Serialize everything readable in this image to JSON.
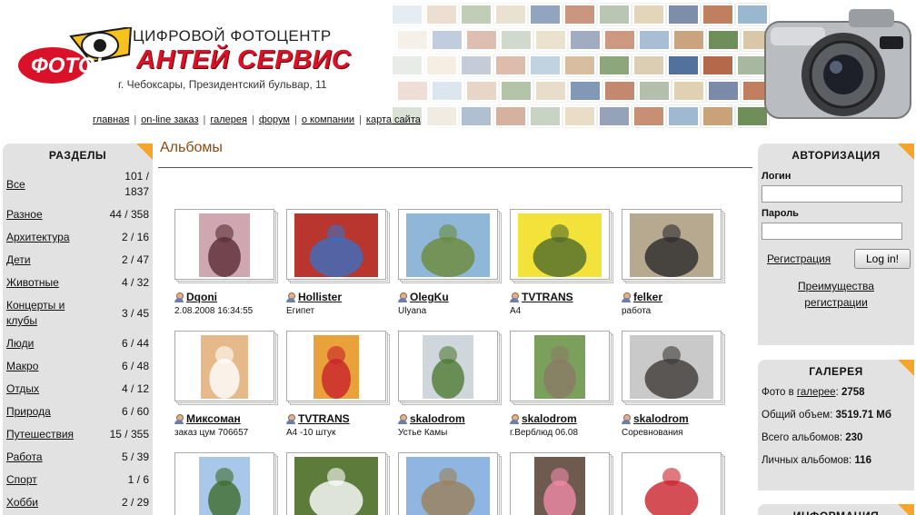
{
  "header": {
    "tagline": "ЦИФРОВОЙ ФОТОЦЕНТР",
    "brand": "АНТЕЙ СЕРВИС",
    "badge_text": "ФОТО!",
    "address": "г. Чебоксары, Президентский бульвар, 11"
  },
  "nav": [
    {
      "label": "главная"
    },
    {
      "label": "on-line заказ"
    },
    {
      "label": "галерея"
    },
    {
      "label": "форум"
    },
    {
      "label": "о компании"
    },
    {
      "label": "карта сайта"
    }
  ],
  "sections": {
    "title": "РАЗДЕЛЫ",
    "items": [
      {
        "label": "Все",
        "count": "101 / 1837"
      },
      {
        "label": "Разное",
        "count": "44 / 358"
      },
      {
        "label": "Архитектура",
        "count": "2 / 16"
      },
      {
        "label": "Дети",
        "count": "2 / 47"
      },
      {
        "label": "Животные",
        "count": "4 / 32"
      },
      {
        "label": "Концерты и клубы",
        "count": "3 / 45"
      },
      {
        "label": "Люди",
        "count": "6 / 44"
      },
      {
        "label": "Макро",
        "count": "6 / 48"
      },
      {
        "label": "Отдых",
        "count": "4 / 12"
      },
      {
        "label": "Природа",
        "count": "6 / 60"
      },
      {
        "label": "Путешествия",
        "count": "15 / 355"
      },
      {
        "label": "Работа",
        "count": "5 / 39"
      },
      {
        "label": "Спорт",
        "count": "1 / 6"
      },
      {
        "label": "Хобби",
        "count": "2 / 29"
      }
    ]
  },
  "main": {
    "title": "Альбомы",
    "albums": [
      {
        "owner": "Dqoni",
        "caption": "2.08.2008 16:34:55",
        "thumb": "portrait-girl"
      },
      {
        "owner": "Hollister",
        "caption": "Египет",
        "thumb": "restaurant-man"
      },
      {
        "owner": "OlegKu",
        "caption": "Ulyana",
        "thumb": "fountain-girl"
      },
      {
        "owner": "TVTRANS",
        "caption": "A4",
        "thumb": "yellow-flyer"
      },
      {
        "owner": "felker",
        "caption": "работа",
        "thumb": "group-photo"
      },
      {
        "owner": "Миксоман",
        "caption": "заказ цум 706657",
        "thumb": "wedding"
      },
      {
        "owner": "TVTRANS",
        "caption": "A4 -10 штук",
        "thumb": "doors-poster"
      },
      {
        "owner": "skalodrom",
        "caption": "Устье Камы",
        "thumb": "river-tree"
      },
      {
        "owner": "skalodrom",
        "caption": "г.Верблюд 06.08",
        "thumb": "kid-rocks"
      },
      {
        "owner": "skalodrom",
        "caption": "Соревнования",
        "thumb": "climbing"
      },
      {
        "owner": "",
        "caption": "",
        "thumb": "pines"
      },
      {
        "owner": "",
        "caption": "",
        "thumb": "daisies"
      },
      {
        "owner": "",
        "caption": "",
        "thumb": "mountains"
      },
      {
        "owner": "",
        "caption": "",
        "thumb": "girl-dress"
      },
      {
        "owner": "",
        "caption": "",
        "thumb": "guards-poster"
      }
    ]
  },
  "auth": {
    "title": "АВТОРИЗАЦИЯ",
    "login_label": "Логин",
    "password_label": "Пароль",
    "register_link": "Регистрация",
    "login_button": "Log in!",
    "benefits_link": "Преимущества регистрации"
  },
  "gallery": {
    "title": "ГАЛЕРЕЯ",
    "photos_prefix": "Фото в ",
    "photos_link": "галерее",
    "photos_sep": ": ",
    "photos_value": "2758",
    "volume_label": "Общий объем: ",
    "volume_value": "3519.71 Мб",
    "albums_label": "Всего альбомов: ",
    "albums_value": "230",
    "personal_label": "Личных альбомов: ",
    "personal_value": "116"
  },
  "info": {
    "title": "ИНФОРМАЦИЯ"
  },
  "colors": {
    "accent_orange": "#f6a52a",
    "panel_gray": "#e2e2e2",
    "brand_red": "#d9122a",
    "title_brown": "#8b4a12"
  }
}
